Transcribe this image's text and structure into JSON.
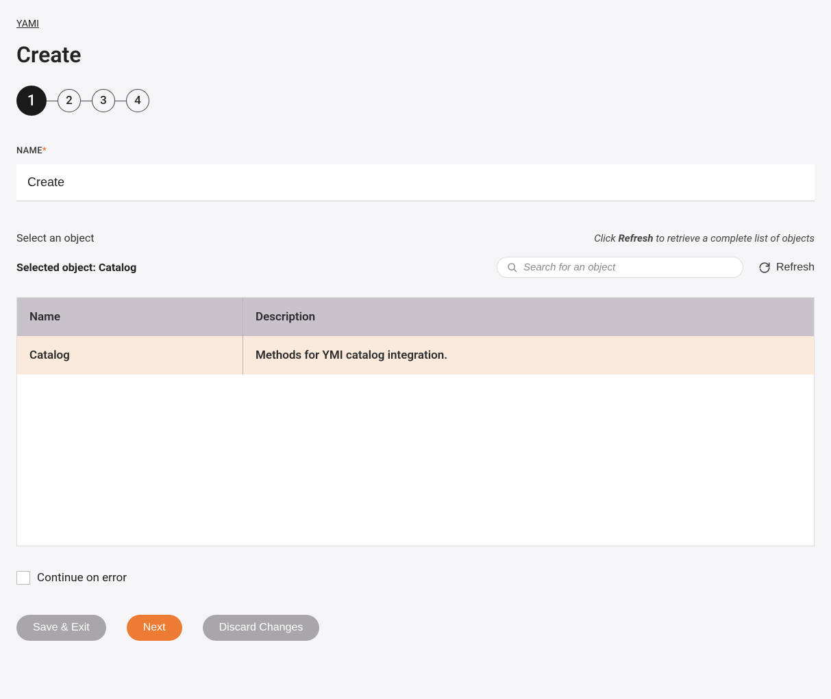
{
  "breadcrumb": "YAMI",
  "page_title": "Create",
  "stepper": {
    "steps": [
      "1",
      "2",
      "3",
      "4"
    ],
    "active_index": 0
  },
  "name_field": {
    "label": "NAME",
    "value": "Create"
  },
  "select_object": {
    "label": "Select an object",
    "hint_prefix": "Click ",
    "hint_bold": "Refresh",
    "hint_suffix": " to retrieve a complete list of objects",
    "selected_label": "Selected object: Catalog",
    "search_placeholder": "Search for an object",
    "refresh_label": "Refresh"
  },
  "table": {
    "headers": {
      "name": "Name",
      "description": "Description"
    },
    "rows": [
      {
        "name": "Catalog",
        "description": "Methods for YMI catalog integration.",
        "selected": true
      }
    ]
  },
  "continue_on_error_label": "Continue on error",
  "buttons": {
    "save_exit": "Save & Exit",
    "next": "Next",
    "discard": "Discard Changes"
  }
}
